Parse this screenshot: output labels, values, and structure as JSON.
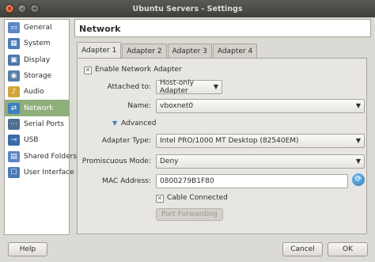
{
  "window": {
    "title": "Ubuntu Servers - Settings"
  },
  "sidebar": {
    "items": [
      {
        "label": "General",
        "icon": "monitor-icon",
        "color": "#5d87c6"
      },
      {
        "label": "System",
        "icon": "chip-icon",
        "color": "#4c7bb8"
      },
      {
        "label": "Display",
        "icon": "display-icon",
        "color": "#4a76ad"
      },
      {
        "label": "Storage",
        "icon": "storage-icon",
        "color": "#5a7ea8"
      },
      {
        "label": "Audio",
        "icon": "audio-icon",
        "color": "#d0a53a"
      },
      {
        "label": "Network",
        "icon": "network-icon",
        "color": "#3f7fbf",
        "selected": true
      },
      {
        "label": "Serial Ports",
        "icon": "serial-port-icon",
        "color": "#4f6f8f"
      },
      {
        "label": "USB",
        "icon": "usb-icon",
        "color": "#3a6ea8"
      },
      {
        "label": "Shared Folders",
        "icon": "folder-icon",
        "color": "#5d87c6"
      },
      {
        "label": "User Interface",
        "icon": "user-interface-icon",
        "color": "#4c7bb8"
      }
    ]
  },
  "page": {
    "title": "Network"
  },
  "tabs": [
    {
      "label": "Adapter 1",
      "active": true
    },
    {
      "label": "Adapter 2"
    },
    {
      "label": "Adapter 3"
    },
    {
      "label": "Adapter 4"
    }
  ],
  "adapter": {
    "enable_label": "Enable Network Adapter",
    "enabled": true,
    "attached_label": "Attached to:",
    "attached_value": "Host-only Adapter",
    "name_label": "Name:",
    "name_value": "vboxnet0",
    "advanced_label": "Advanced",
    "type_label": "Adapter Type:",
    "type_value": "Intel PRO/1000 MT Desktop (82540EM)",
    "promisc_label": "Promiscuous Mode:",
    "promisc_value": "Deny",
    "mac_label": "MAC Address:",
    "mac_value": "0800279B1F80",
    "cable_label": "Cable Connected",
    "cable_connected": true,
    "port_forwarding_label": "Port Forwarding"
  },
  "footer": {
    "help": "Help",
    "cancel": "Cancel",
    "ok": "OK"
  }
}
